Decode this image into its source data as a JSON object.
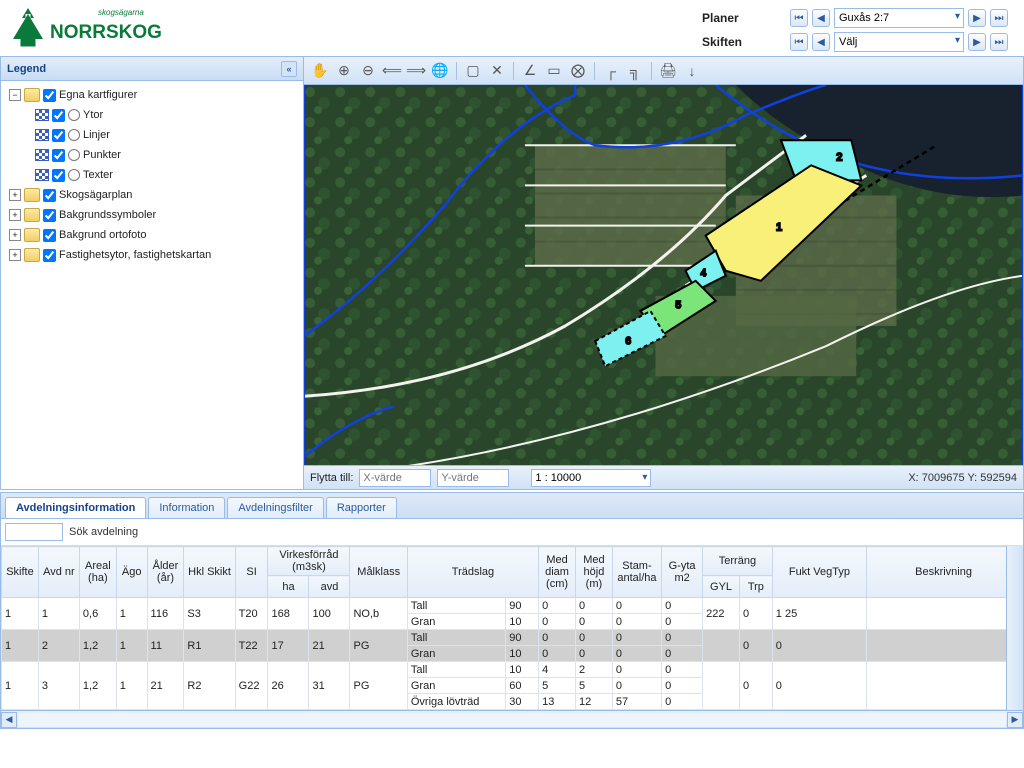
{
  "brand": {
    "name": "NORRSKOG",
    "tagline": "skogsägarna"
  },
  "nav": {
    "planer_label": "Planer",
    "skiften_label": "Skiften",
    "planer_value": "Guxås 2:7",
    "skiften_value": "Välj"
  },
  "legend": {
    "title": "Legend",
    "nodes": [
      {
        "indent": 1,
        "expand": "−",
        "folder": true,
        "check": true,
        "label": "Egna kartfigurer"
      },
      {
        "indent": 2,
        "swatch": true,
        "check": true,
        "radio": true,
        "label": "Ytor"
      },
      {
        "indent": 2,
        "swatch": true,
        "check": true,
        "radio": true,
        "label": "Linjer"
      },
      {
        "indent": 2,
        "swatch": true,
        "check": true,
        "radio": true,
        "label": "Punkter"
      },
      {
        "indent": 2,
        "swatch": true,
        "check": true,
        "radio": true,
        "label": "Texter"
      },
      {
        "indent": 1,
        "expand": "+",
        "folder": true,
        "check": true,
        "label": "Skogsägarplan"
      },
      {
        "indent": 1,
        "expand": "+",
        "folder": true,
        "check": true,
        "label": "Bakgrundssymboler"
      },
      {
        "indent": 1,
        "expand": "+",
        "folder": true,
        "check": true,
        "label": "Bakgrund ortofoto"
      },
      {
        "indent": 1,
        "expand": "+",
        "folder": true,
        "check": true,
        "label": "Fastighetsytor, fastighetskartan"
      }
    ]
  },
  "toolbar_icons": [
    "✋",
    "⊕",
    "⊖",
    "⟸",
    "⟹",
    "🌐",
    "│",
    "▢",
    "✕",
    "│",
    "∠",
    "▭",
    "⨂",
    "│",
    "┌",
    "╗",
    "│",
    "🖨",
    "↓"
  ],
  "map_bottom": {
    "flytta_label": "Flytta till:",
    "x_placeholder": "X-värde",
    "y_placeholder": "Y-värde",
    "scale": "1 : 10000",
    "coords": "X: 7009675  Y: 592594"
  },
  "tabs": [
    "Avdelningsinformation",
    "Information",
    "Avdelningsfilter",
    "Rapporter"
  ],
  "active_tab": 0,
  "search_label": "Sök avdelning",
  "table": {
    "headers_main": [
      "Skifte",
      "Avd nr",
      "Areal (ha)",
      "Ägo",
      "Ålder (år)",
      "Hkl Skikt",
      "SI",
      "Virkesförråd (m3sk)",
      "Målklass",
      "Trädslag",
      "Med diam (cm)",
      "Med höjd (m)",
      "Stam-antal/ha",
      "G-yta m2",
      "Terräng",
      "Fukt VegTyp",
      "Beskrivning"
    ],
    "sub_virke": [
      "ha",
      "avd"
    ],
    "sub_terrang": [
      "GYL",
      "Trp"
    ],
    "rows": [
      {
        "skifte": "1",
        "avd": "1",
        "areal": "0,6",
        "ago": "1",
        "alder": "116",
        "hkl": "S3",
        "si": "T20",
        "v_ha": "168",
        "v_avd": "100",
        "mal": "NO,b",
        "tradslag": [
          [
            "Tall",
            "90",
            "0",
            "0",
            "0",
            "0"
          ],
          [
            "Gran",
            "10",
            "0",
            "0",
            "0",
            "0"
          ]
        ],
        "gyl": "222",
        "trp": "0",
        "fukt": "1 25",
        "besk": ""
      },
      {
        "skifte": "1",
        "avd": "2",
        "areal": "1,2",
        "ago": "1",
        "alder": "11",
        "hkl": "R1",
        "si": "T22",
        "v_ha": "17",
        "v_avd": "21",
        "mal": "PG",
        "tradslag": [
          [
            "Tall",
            "90",
            "0",
            "0",
            "0",
            "0"
          ],
          [
            "Gran",
            "10",
            "0",
            "0",
            "0",
            "0"
          ]
        ],
        "gyl": "",
        "trp": "0",
        "fukt": "0",
        "besk": "",
        "sel": true
      },
      {
        "skifte": "1",
        "avd": "3",
        "areal": "1,2",
        "ago": "1",
        "alder": "21",
        "hkl": "R2",
        "si": "G22",
        "v_ha": "26",
        "v_avd": "31",
        "mal": "PG",
        "tradslag": [
          [
            "Tall",
            "10",
            "4",
            "2",
            "0",
            "0"
          ],
          [
            "Gran",
            "60",
            "5",
            "5",
            "0",
            "0"
          ],
          [
            "Övriga lövträd",
            "30",
            "13",
            "12",
            "57",
            "0"
          ]
        ],
        "gyl": "",
        "trp": "0",
        "fukt": "0",
        "besk": ""
      }
    ]
  },
  "map_parcels": [
    {
      "id": "2",
      "fill": "#7df0f0"
    },
    {
      "id": "1",
      "fill": "#f9f07a"
    },
    {
      "id": "4",
      "fill": "#7df0f0"
    },
    {
      "id": "5",
      "fill": "#7ce57a"
    },
    {
      "id": "6",
      "fill": "#7df0f0"
    }
  ]
}
